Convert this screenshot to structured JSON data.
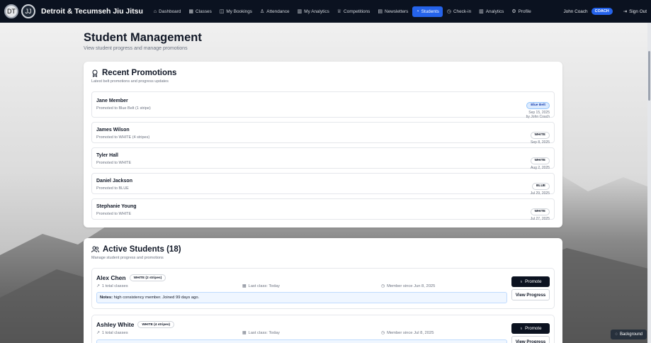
{
  "app": {
    "brand": "Detroit & Tecumseh Jiu Jitsu",
    "logo1": "DT",
    "logo2": "JJ"
  },
  "nav": [
    {
      "label": "Dashboard",
      "icon": "⌂",
      "icon_name": "home-icon"
    },
    {
      "label": "Classes",
      "icon": "▦",
      "icon_name": "calendar-icon"
    },
    {
      "label": "My Bookings",
      "icon": "◫",
      "icon_name": "book-icon"
    },
    {
      "label": "Attendance",
      "icon": "♙",
      "icon_name": "user-check-icon"
    },
    {
      "label": "My Analytics",
      "icon": "▥",
      "icon_name": "bar-chart-icon"
    },
    {
      "label": "Competitions",
      "icon": "♕",
      "icon_name": "trophy-icon"
    },
    {
      "label": "Newsletters",
      "icon": "▤",
      "icon_name": "newspaper-icon"
    },
    {
      "label": "Students",
      "icon": "◔",
      "icon_name": "graduation-cap-icon",
      "active": true
    },
    {
      "label": "Check-in",
      "icon": "◷",
      "icon_name": "clock-icon"
    },
    {
      "label": "Analytics",
      "icon": "▥",
      "icon_name": "bar-chart-icon"
    },
    {
      "label": "Profile",
      "icon": "⚙",
      "icon_name": "gear-icon"
    }
  ],
  "user": {
    "name": "John Coach",
    "role": "COACH",
    "sign_out": "Sign Out",
    "sign_out_icon": "⇥"
  },
  "page": {
    "title": "Student Management",
    "subtitle": "View student progress and manage promotions"
  },
  "recent": {
    "title": "Recent Promotions",
    "subtitle": "Latest belt promotions and progress updates",
    "items": [
      {
        "name": "Jane Member",
        "desc": "Promoted to Blue Belt (1 stripe)",
        "badge": "Blue Belt",
        "badge_style": "blue",
        "date": "Sep 15, 2025",
        "by": "by John Coach"
      },
      {
        "name": "James Wilson",
        "desc": "Promoted to WHITE (4 stripes)",
        "badge": "WHITE",
        "badge_style": "white",
        "date": "Sep 8, 2025",
        "by": ""
      },
      {
        "name": "Tyler Hall",
        "desc": "Promoted to WHITE",
        "badge": "WHITE",
        "badge_style": "white",
        "date": "Aug 2, 2025",
        "by": ""
      },
      {
        "name": "Daniel Jackson",
        "desc": "Promoted to BLUE",
        "badge": "BLUE",
        "badge_style": "white",
        "date": "Jul 29, 2025",
        "by": ""
      },
      {
        "name": "Stephanie Young",
        "desc": "Promoted to WHITE",
        "badge": "WHITE",
        "badge_style": "white",
        "date": "Jul 27, 2025",
        "by": ""
      }
    ]
  },
  "active": {
    "title": "Active Students (18)",
    "subtitle": "Manage student progress and promotions",
    "promote_label": "Promote",
    "progress_label": "View Progress",
    "students": [
      {
        "name": "Alex Chen",
        "belt": "WHITE (2 stripes)",
        "classes": "1 total classes",
        "last": "Last class: Today",
        "since": "Member since Jun 8, 2025",
        "notes_label": "Notes:",
        "notes": "high consistency member. Joined 99 days ago."
      },
      {
        "name": "Ashley White",
        "belt": "WHITE (4 stripes)",
        "classes": "1 total classes",
        "last": "Last class: Today",
        "since": "Member since Jul 8, 2025",
        "notes_label": "",
        "notes": ""
      }
    ]
  },
  "background_button": "Background",
  "colors": {
    "topbar": "#0b1220",
    "accent": "#2563eb",
    "primary_button": "#0b1220",
    "notes_bg": "#eff6ff"
  }
}
